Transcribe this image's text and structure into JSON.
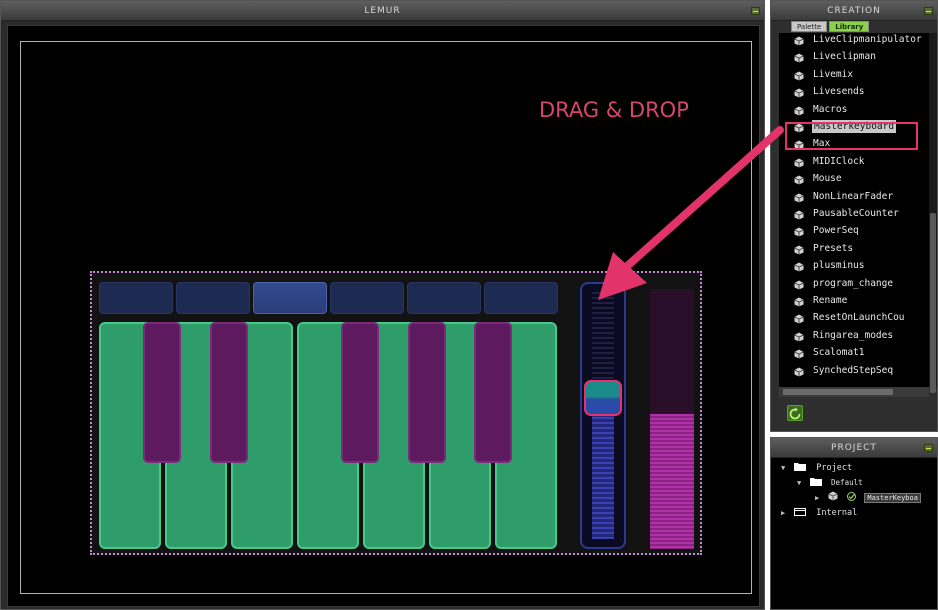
{
  "lemur_panel": {
    "title": "LEMUR"
  },
  "annotation": {
    "drag_text": "DRAG & DROP"
  },
  "keyboard": {
    "preset_buttons": 6,
    "selected_preset_index": 2,
    "white_keys": 7,
    "black_keys": 5,
    "fader_value_fraction": 0.45,
    "side_meter_fraction": 0.52
  },
  "creation_panel": {
    "title": "CREATION",
    "tabs": [
      {
        "label": "Palette",
        "active": false
      },
      {
        "label": "Library",
        "active": true
      }
    ],
    "library_items": [
      "LiveClipmanipulator",
      "Liveclipman",
      "Livemix",
      "Livesends",
      "Macros",
      "Masterkeyboard",
      "Max",
      "MIDIClock",
      "Mouse",
      "NonLinearFader",
      "PausableCounter",
      "PowerSeq",
      "Presets",
      "plusminus",
      "program_change",
      "Rename",
      "ResetOnLaunchCou",
      "Ringarea_modes",
      "Scalomat1",
      "SynchedStepSeq"
    ],
    "highlighted_item_index": 5
  },
  "project_panel": {
    "title": "PROJECT",
    "tree": [
      {
        "label": "Project",
        "level": 0,
        "expanded": true
      },
      {
        "label": "Default",
        "level": 1,
        "expanded": true
      },
      {
        "label": "MasterKeyboa",
        "level": 2,
        "expanded": false
      },
      {
        "label": "Internal",
        "level": 0,
        "expanded": false
      }
    ]
  },
  "colors": {
    "annotation": "#e2336a",
    "white_key": "#2e9d6a",
    "black_key": "#5e1a5e",
    "preset_button": "#1d2a52",
    "accent_green": "#8ad24a"
  }
}
